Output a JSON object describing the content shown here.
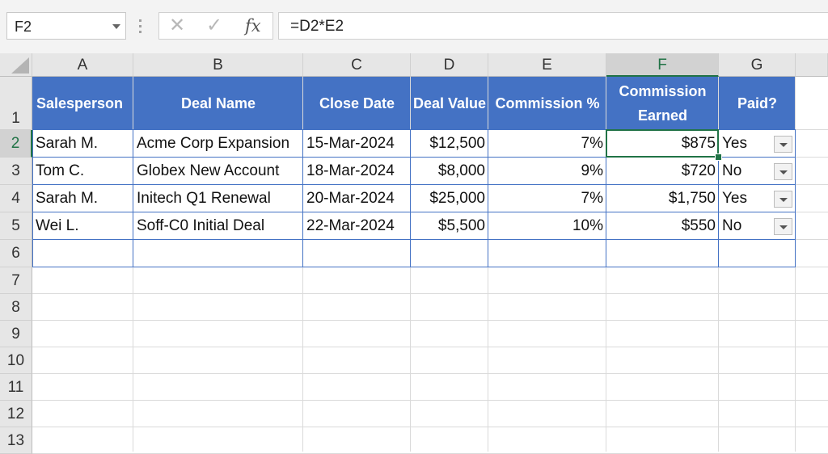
{
  "formula_bar": {
    "name_box": "F2",
    "cancel_icon": "✕",
    "enter_icon": "✓",
    "fx_label": "fx",
    "formula": "=D2*E2"
  },
  "columns": [
    "A",
    "B",
    "C",
    "D",
    "E",
    "F",
    "G"
  ],
  "rows": [
    "1",
    "2",
    "3",
    "4",
    "5",
    "6",
    "7",
    "8",
    "9",
    "10",
    "11",
    "12",
    "13"
  ],
  "selected_cell": "F2",
  "table": {
    "headers": [
      "Salesperson",
      "Deal Name",
      "Close Date",
      "Deal Value",
      "Commission %",
      "Commission Earned",
      "Paid?"
    ],
    "rows": [
      [
        "Sarah M.",
        "Acme Corp Expansion",
        "15-Mar-2024",
        "$12,500",
        "7%",
        "$875",
        "Yes"
      ],
      [
        "Tom C.",
        "Globex New Account",
        "18-Mar-2024",
        "$8,000",
        "9%",
        "$720",
        "No"
      ],
      [
        "Sarah M.",
        "Initech Q1 Renewal",
        "20-Mar-2024",
        "$25,000",
        "7%",
        "$1,750",
        "Yes"
      ],
      [
        "Wei L.",
        "Soff-C0 Initial Deal",
        "22-Mar-2024",
        "$5,500",
        "10%",
        "$550",
        "No"
      ]
    ]
  },
  "colors": {
    "header_fill": "#4472c4",
    "selection": "#217346",
    "table_border": "#4472c4"
  }
}
